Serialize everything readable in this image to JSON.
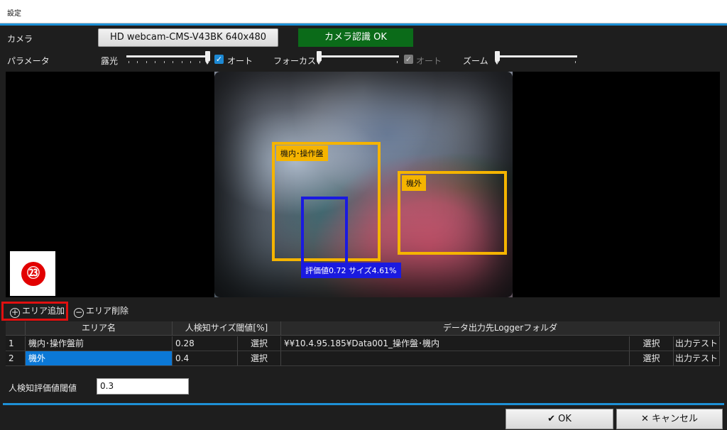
{
  "window": {
    "title": "設定"
  },
  "camera": {
    "label": "カメラ",
    "device_button": "HD webcam-CMS-V43BK  640x480",
    "status": "カメラ認識 OK",
    "status_color": "#0b6b19"
  },
  "params": {
    "label": "パラメータ",
    "exposure": {
      "label": "露光",
      "auto_label": "オート",
      "auto_checked": true,
      "level": 1.0
    },
    "focus": {
      "label": "フォーカス",
      "auto_label": "オート",
      "auto_checked": true,
      "auto_disabled": true,
      "level": 0.0
    },
    "zoom": {
      "label": "ズーム",
      "level": 0.0
    }
  },
  "preview": {
    "areas": [
      {
        "label": "機内･操作盤",
        "color": "#f5b400"
      },
      {
        "label": "機外",
        "color": "#f5b400"
      }
    ],
    "detection": {
      "label": "評価値0.72 サイズ4.61%",
      "color": "#1a1ae0"
    }
  },
  "step_badge": "㉓",
  "area_actions": {
    "add": "エリア追加",
    "remove": "エリア削除",
    "add_icon": "plus-circle-icon",
    "remove_icon": "minus-circle-icon"
  },
  "table": {
    "headers": [
      "エリア名",
      "人検知サイズ閾値[%]",
      "データ出力先Loggerフォルダ"
    ],
    "select_label": "選択",
    "test_label": "出力テスト",
    "rows": [
      {
        "num": "1",
        "name": "機内･操作盤前",
        "threshold": "0.28",
        "folder": "¥¥10.4.95.185¥Data001_操作盤･機内"
      },
      {
        "num": "2",
        "name": "機外",
        "threshold": "0.4",
        "folder": ""
      }
    ]
  },
  "eval_threshold": {
    "label": "人検知評価値閾値",
    "value": "0.3"
  },
  "footer": {
    "ok": "OK",
    "cancel": "キャンセル",
    "ok_icon": "check-icon",
    "cancel_icon": "x-icon"
  }
}
